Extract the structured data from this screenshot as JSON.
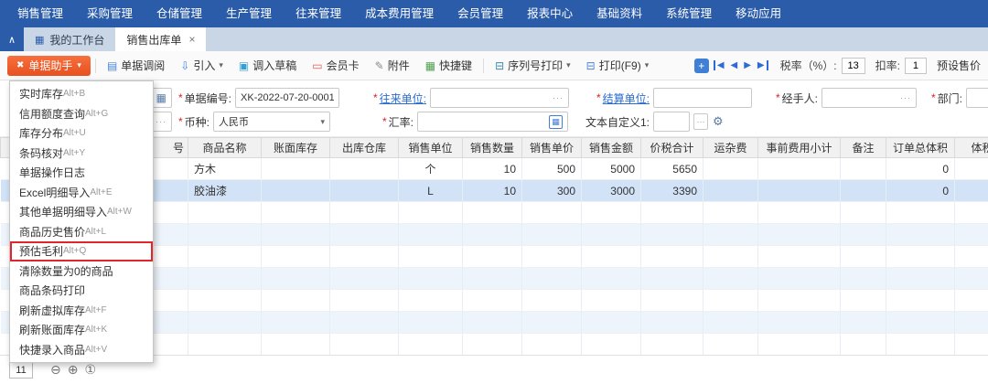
{
  "colors": {
    "topnav_blue": "#2a5caa",
    "assistant_orange": "#e8501f",
    "link_blue": "#2a6bd2",
    "highlight_red": "#e0262b",
    "selected_row": "#d2e3f7"
  },
  "topnav": {
    "items": [
      "销售管理",
      "采购管理",
      "仓储管理",
      "生产管理",
      "往来管理",
      "成本费用管理",
      "会员管理",
      "报表中心",
      "基础资料",
      "系统管理",
      "移动应用"
    ]
  },
  "tabs": {
    "workbench": "我的工作台",
    "active": "销售出库单",
    "close": "×"
  },
  "icons": {
    "collapse": "∧",
    "workbench": "▦",
    "assistant": "✖",
    "dropdown": "▾",
    "review": "▤",
    "import": "⇩",
    "draft": "▣",
    "member": "▭",
    "attachment": "✎",
    "hotkeys": "▦",
    "serial_print": "⊟",
    "print": "⊟",
    "add_new": "+",
    "nav_prev": "◀",
    "nav_next": "▶",
    "calendar": "▦",
    "calculator": "▦",
    "gear": "⚙",
    "ellipsis": "···",
    "minus_circle": "⊖",
    "plus_circle": "⊕",
    "one_circle": "①"
  },
  "toolbar": {
    "assistant": "单据助手",
    "review": "单据调阅",
    "import": "引入",
    "draft": "调入草稿",
    "member_card": "会员卡",
    "attachment": "附件",
    "hotkeys": "快捷键",
    "serial_print": "序列号打印",
    "print": "打印(F9)",
    "tax_rate_label": "税率（%）:",
    "tax_rate_value": "13",
    "discount_label": "扣率:",
    "discount_value": "1",
    "preset_price": "预设售价"
  },
  "form": {
    "required_mark": "*",
    "doc_no_label": "单据编号:",
    "doc_no_value": "XK-2022-07-20-0001",
    "partner_label": "往来单位:",
    "settlement_label": "结算单位:",
    "handler_label": "经手人:",
    "department_label": "部门:",
    "currency_label": "币种:",
    "currency_value": "人民币",
    "exchange_rate_label": "汇率:",
    "custom_text_label": "文本自定义1:"
  },
  "menu": {
    "items": [
      {
        "label": "实时库存",
        "shortcut": "Alt+B"
      },
      {
        "label": "信用额度查询",
        "shortcut": "Alt+G"
      },
      {
        "label": "库存分布",
        "shortcut": "Alt+U"
      },
      {
        "label": "条码核对",
        "shortcut": "Alt+Y"
      },
      {
        "label": "单据操作日志",
        "shortcut": ""
      },
      {
        "label": "Excel明细导入",
        "shortcut": "Alt+E"
      },
      {
        "label": "其他单据明细导入",
        "shortcut": "Alt+W"
      },
      {
        "label": "商品历史售价",
        "shortcut": "Alt+L"
      },
      {
        "label": "预估毛利",
        "shortcut": "Alt+Q"
      },
      {
        "label": "清除数量为0的商品",
        "shortcut": ""
      },
      {
        "label": "商品条码打印",
        "shortcut": ""
      },
      {
        "label": "刷新虚拟库存",
        "shortcut": "Alt+F"
      },
      {
        "label": "刷新账面库存",
        "shortcut": "Alt+K"
      },
      {
        "label": "快捷录入商品",
        "shortcut": "Alt+V"
      }
    ]
  },
  "grid": {
    "headers": [
      "号",
      "商品名称",
      "账面库存",
      "出库仓库",
      "销售单位",
      "销售数量",
      "销售单价",
      "销售金额",
      "价税合计",
      "运杂费",
      "事前费用小计",
      "备注",
      "订单总体积",
      "体积"
    ],
    "rows": [
      {
        "product_name": "方木",
        "unit": "个",
        "quantity": "10",
        "unit_price": "500",
        "amount": "5000",
        "tax_total": "5650",
        "order_volume": "0"
      },
      {
        "product_name": "胶油漆",
        "unit": "L",
        "quantity": "10",
        "unit_price": "300",
        "amount": "3000",
        "tax_total": "3390",
        "order_volume": "0"
      }
    ]
  },
  "footer": {
    "row_count": "11"
  }
}
